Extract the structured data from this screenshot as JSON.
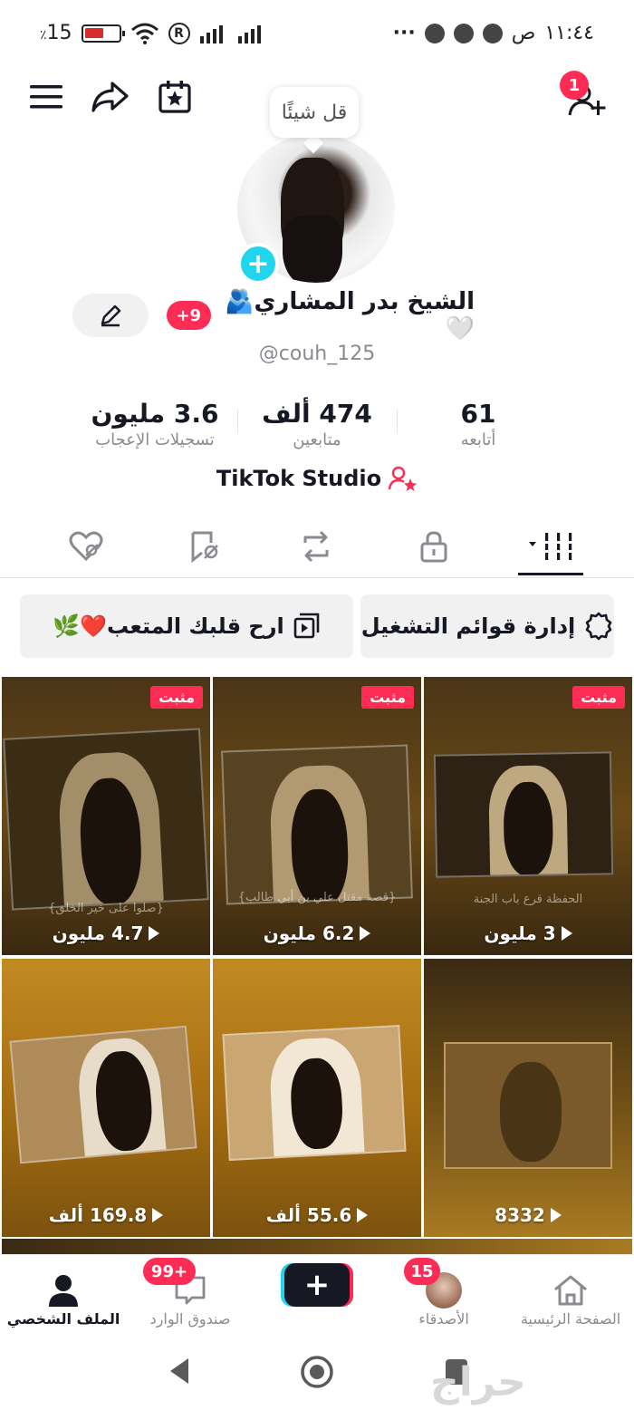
{
  "status_bar": {
    "battery": "15",
    "battery_unit": "٪",
    "time": "١١:٤٤",
    "ampm": "ص",
    "dots": "···"
  },
  "header": {
    "notification_count": "1"
  },
  "profile": {
    "bubble_text": "قل شيئًا",
    "name": "الشيخ بدر المشاري🫂🤍",
    "name_badge": "+9",
    "username": "@couh_125",
    "stats": [
      {
        "value": "3.6 مليون",
        "label": "تسجيلات الإعجاب"
      },
      {
        "value": "474 ألف",
        "label": "متابعين"
      },
      {
        "value": "61",
        "label": "أتابعه"
      }
    ],
    "studio_label": "TikTok Studio"
  },
  "playlists": {
    "manage_label": "إدارة قوائم التشغيل",
    "playlist_label": "ارح قلبك المتعب❤️🌿"
  },
  "videos": [
    {
      "pinned": "مثبت",
      "views": "4.7 مليون",
      "caption": "{صلوا على خير الخلق}"
    },
    {
      "pinned": "مثبت",
      "views": "6.2 مليون",
      "caption": "{قصة مقتل علي بن أبي طالب}"
    },
    {
      "pinned": "مثبت",
      "views": "3 مليون",
      "caption": "الحفظة قرع باب الجنة"
    },
    {
      "views": "169.8 ألف"
    },
    {
      "views": "55.6 ألف"
    },
    {
      "views": "8332"
    }
  ],
  "bottom_nav": {
    "profile": "الملف الشخصي",
    "inbox": "صندوق الوارد",
    "inbox_badge": "99+",
    "plus": "+",
    "friends": "الأصدقاء",
    "friends_badge": "15",
    "home": "الصفحة الرئيسية"
  },
  "watermark": "حراج",
  "colors": {
    "accent": "#fe2c55",
    "cyan": "#20d5ec",
    "text": "#161823",
    "muted": "#8a8b91"
  }
}
